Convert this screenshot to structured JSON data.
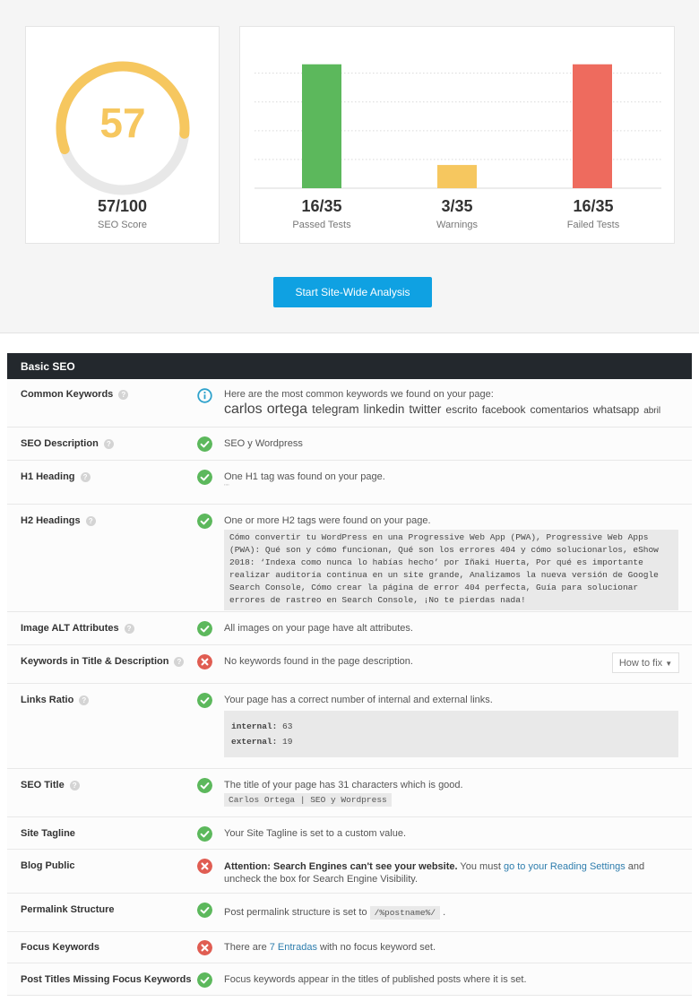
{
  "score": {
    "value": 57,
    "max": 100,
    "display": "57",
    "fraction": "57/100",
    "label": "SEO Score",
    "color": "#f6c75f",
    "track_color": "#e8e8e8"
  },
  "chart_data": {
    "type": "bar",
    "categories": [
      "Passed Tests",
      "Warnings",
      "Failed Tests"
    ],
    "values": [
      16,
      3,
      16
    ],
    "total": 35,
    "labels": [
      "16/35",
      "3/35",
      "16/35"
    ],
    "colors": [
      "#5cb85c",
      "#f6c75f",
      "#ee6b5e"
    ],
    "title": "",
    "xlabel": "",
    "ylabel": "",
    "ylim": [
      0,
      18
    ],
    "grid": true
  },
  "actions": {
    "analyze_label": "Start Site-Wide Analysis"
  },
  "panel": {
    "title": "Basic SEO",
    "rows": [
      {
        "label": "Common Keywords",
        "status": "info",
        "text": "Here are the most common keywords we found on your page:",
        "keywords": [
          {
            "word": "carlos",
            "size": 3
          },
          {
            "word": "ortega",
            "size": 3
          },
          {
            "word": "telegram",
            "size": 2
          },
          {
            "word": "linkedin",
            "size": 2
          },
          {
            "word": "twitter",
            "size": 2
          },
          {
            "word": "escrito",
            "size": 1
          },
          {
            "word": "facebook",
            "size": 1
          },
          {
            "word": "comentarios",
            "size": 1
          },
          {
            "word": "whatsapp",
            "size": 1
          },
          {
            "word": "abril",
            "size": 0
          }
        ]
      },
      {
        "label": "SEO Description",
        "status": "pass",
        "text": "SEO y Wordpress"
      },
      {
        "label": "H1 Heading",
        "status": "pass",
        "text": "One H1 tag was found on your page.",
        "sub": "\"\""
      },
      {
        "label": "H2 Headings",
        "status": "pass",
        "text": "One or more H2 tags were found on your page.",
        "code": "Cómo convertir tu WordPress en una Progressive Web App (PWA), Progressive Web Apps (PWA): Qué son y cómo funcionan, Qué son los errores 404 y cómo solucionarlos, eShow 2018: ‘Indexa como nunca lo habías hecho’ por Iñaki Huerta, Por qué es importante realizar auditoría continua en un site grande, Analizamos la nueva versión de Google Search Console, Cómo crear la página de error 404 perfecta, Guía para solucionar errores de rastreo en Search Console, ¡No te pierdas nada!"
      },
      {
        "label": "Image ALT Attributes",
        "status": "pass",
        "text": "All images on your page have alt attributes."
      },
      {
        "label": "Keywords in Title & Description",
        "status": "fail",
        "text": "No keywords found in the page description.",
        "button": "How to fix"
      },
      {
        "label": "Links Ratio",
        "status": "pass",
        "text": "Your page has a correct number of internal and external links.",
        "internal_label": "internal:",
        "internal": "63",
        "external_label": "external:",
        "external": "19"
      },
      {
        "label": "SEO Title",
        "status": "pass",
        "text": "The title of your page has 31 characters which is good.",
        "code": "Carlos Ortega | SEO y Wordpress"
      },
      {
        "label": "Site Tagline",
        "status": "pass",
        "text": "Your Site Tagline is set to a custom value."
      },
      {
        "label": "Blog Public",
        "status": "fail",
        "bold": "Attention: Search Engines can't see your website.",
        "pre": " You must ",
        "link": "go to your Reading Settings",
        "post": " and uncheck the box for Search Engine Visibility."
      },
      {
        "label": "Permalink Structure",
        "status": "pass",
        "text": "Post permalink structure is set to",
        "code": "/%postname%/",
        "post": "."
      },
      {
        "label": "Focus Keywords",
        "status": "fail",
        "pre": "There are ",
        "link": "7 Entradas",
        "post": " with no focus keyword set."
      },
      {
        "label": "Post Titles Missing Focus Keywords",
        "status": "pass",
        "text": "Focus keywords appear in the titles of published posts where it is set."
      }
    ]
  },
  "status_colors": {
    "pass": "#5cb85c",
    "fail": "#e05d52",
    "info": "#2ea2cc"
  }
}
